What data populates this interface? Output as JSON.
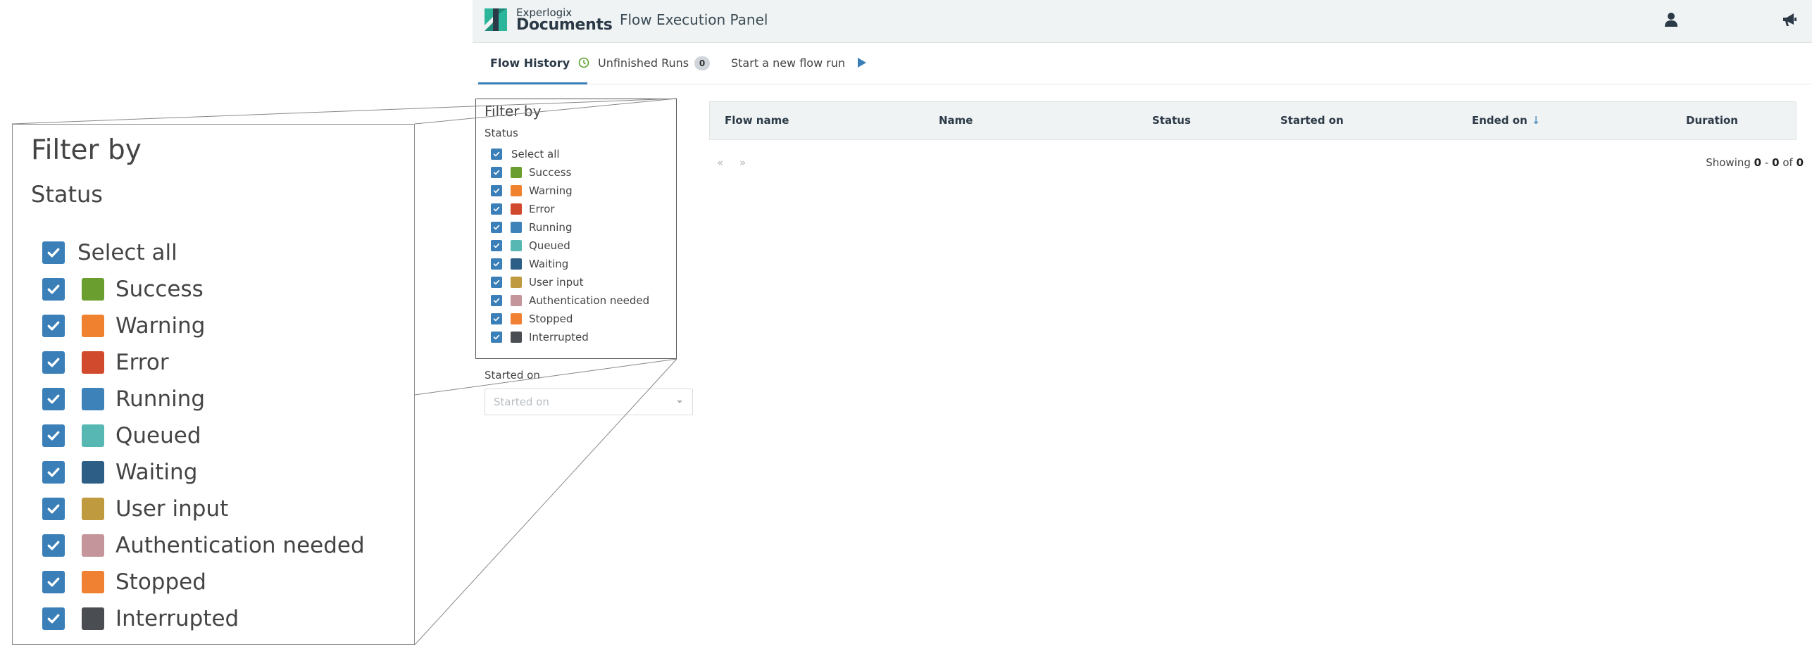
{
  "header": {
    "brand_small": "Experlogix",
    "brand_big": "Documents",
    "app_title": "Flow Execution Panel",
    "icons": [
      "user-icon",
      "announcement-icon"
    ]
  },
  "tabs": [
    {
      "label": "Flow History",
      "icon": "history-icon",
      "active": true
    },
    {
      "label": "Unfinished Runs",
      "badge": "0"
    },
    {
      "label": "Start a new flow run",
      "icon": "play-icon"
    }
  ],
  "filter": {
    "title": "Filter by",
    "status_label": "Status",
    "items": [
      {
        "label": "Select all",
        "checked": true
      },
      {
        "label": "Success",
        "color": "#6a9e2e",
        "checked": true
      },
      {
        "label": "Warning",
        "color": "#f0822f",
        "checked": true
      },
      {
        "label": "Error",
        "color": "#d24a2d",
        "checked": true
      },
      {
        "label": "Running",
        "color": "#3d82b8",
        "checked": true
      },
      {
        "label": "Queued",
        "color": "#56b7b3",
        "checked": true
      },
      {
        "label": "Waiting",
        "color": "#2d5e86",
        "checked": true
      },
      {
        "label": "User input",
        "color": "#c09a3e",
        "checked": true
      },
      {
        "label": "Authentication needed",
        "color": "#c4959a",
        "checked": true
      },
      {
        "label": "Stopped",
        "color": "#f08132",
        "checked": true
      },
      {
        "label": "Interrupted",
        "color": "#4a4d52",
        "checked": true
      }
    ],
    "started_on_label": "Started on",
    "started_on_placeholder": "Started on"
  },
  "table": {
    "columns": [
      "Flow name",
      "Name",
      "Status",
      "Started on",
      "Ended on",
      "Duration"
    ],
    "sort_column": "Ended on",
    "sort_direction": "descending",
    "pager": {
      "first": "«",
      "next": "»"
    },
    "showing": {
      "prefix": "Showing",
      "from": "0",
      "sep": "-",
      "to": "0",
      "of": "of",
      "total": "0"
    }
  },
  "colors": {
    "accent": "#3a7fb8",
    "header_bg": "#eff3f3",
    "success_icon": "#5aa02c"
  }
}
